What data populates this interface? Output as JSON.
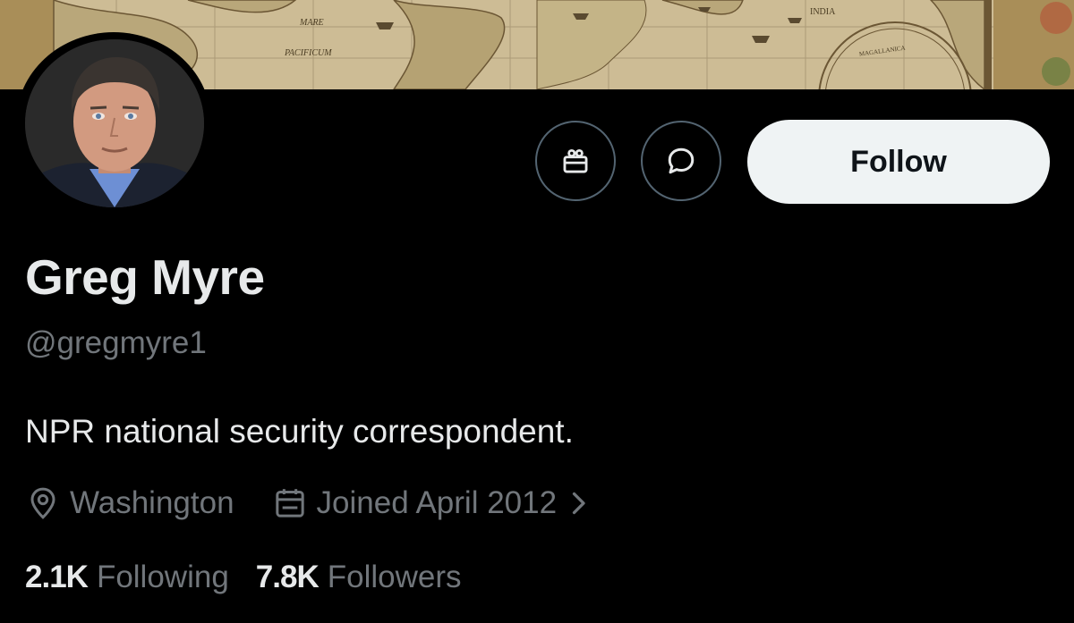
{
  "banner": {
    "map_labels": [
      "MARE",
      "PACIFICUM",
      "INDIA",
      "MAGALLANICA"
    ]
  },
  "profile": {
    "display_name": "Greg Myre",
    "handle": "@gregmyre1",
    "bio": "NPR national security correspondent.",
    "location": "Washington",
    "joined": "Joined April 2012"
  },
  "actions": {
    "follow_label": "Follow",
    "gift_icon": "gift-icon",
    "message_icon": "message-icon"
  },
  "stats": {
    "following_count": "2.1K",
    "following_label": "Following",
    "followers_count": "7.8K",
    "followers_label": "Followers"
  },
  "colors": {
    "background": "#000000",
    "primary_text": "#e7e9ea",
    "secondary_text": "#71767b",
    "button_bg": "#eff3f4",
    "button_text": "#0f1419",
    "border": "#536471"
  }
}
